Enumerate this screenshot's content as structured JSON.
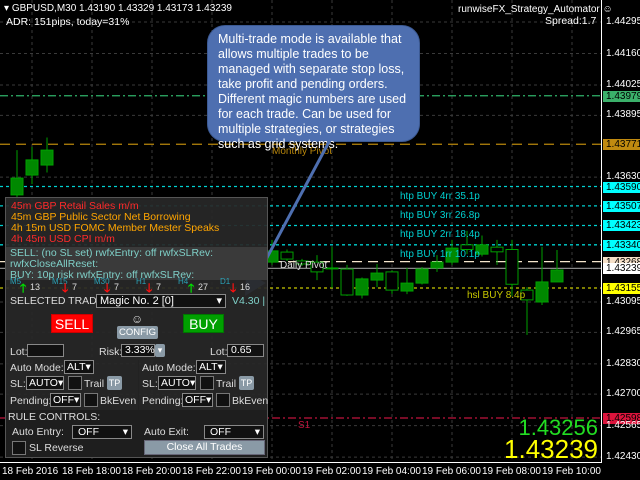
{
  "header": {
    "symbol_line": "GBPUSD,M30  1.43190 1.43329 1.43173 1.43239",
    "adr": "ADR: 151pips, today=31%",
    "ea_name": "runwiseFX_Strategy_Automator",
    "spread": "Spread:1.7"
  },
  "price_axis": [
    "1.44295",
    "1.44160",
    "1.44025",
    "1.43895",
    "1.43630",
    "1.43095",
    "1.42965",
    "1.42830",
    "1.42700",
    "1.42565",
    "1.42430"
  ],
  "levels": [
    {
      "price": 1.43979,
      "text": "1.43979",
      "color": "#2fb36a",
      "style": "dashdot",
      "badge_bg": "#3bb06a",
      "label": ""
    },
    {
      "price": 1.43771,
      "text": "1.43771",
      "color": "#b8860b",
      "style": "dashed",
      "badge_bg": "#c08a10",
      "label": "Monthly Pivot"
    },
    {
      "price": 1.4359,
      "text": "1.43590",
      "color": "#00d0d0",
      "style": "dotted",
      "badge_bg": "#00ffff",
      "label": "htp BUY 4rr 35.1p"
    },
    {
      "price": 1.43507,
      "text": "1.43507",
      "color": "#00d0d0",
      "style": "dotted",
      "badge_bg": "#00ffff",
      "label": "htp BUY 3rr 26.8p"
    },
    {
      "price": 1.43423,
      "text": "1.43423",
      "color": "#00d0d0",
      "style": "dotted",
      "badge_bg": "#00ffff",
      "label": "htp BUY 2rr 18.4p"
    },
    {
      "price": 1.4334,
      "text": "1.43340",
      "color": "#00d0d0",
      "style": "dotted",
      "badge_bg": "#00ffff",
      "label": "htp BUY 1rr 10.1p"
    },
    {
      "price": 1.43268,
      "text": "1.43268",
      "color": "#f5e6cc",
      "style": "dashed",
      "badge_bg": "#f5e0c8",
      "label": "Daily Pivot"
    },
    {
      "price": 1.43239,
      "text": "1.43239",
      "color": "#888888",
      "style": "solid",
      "badge_bg": "#ffffff",
      "label": ""
    },
    {
      "price": 1.43155,
      "text": "1.43155",
      "color": "#c8c800",
      "style": "dotted",
      "badge_bg": "#ffff00",
      "label": "hsl BUY 8.4p"
    },
    {
      "price": 1.42598,
      "text": "1.42598",
      "color": "#c0143c",
      "style": "dashdot",
      "badge_bg": "#dc143c",
      "label": "S1"
    }
  ],
  "time_axis": [
    "18 Feb 2016",
    "18 Feb 18:00",
    "18 Feb 20:00",
    "18 Feb 22:00",
    "19 Feb 00:00",
    "19 Feb 02:00",
    "19 Feb 04:00",
    "19 Feb 06:00",
    "19 Feb 08:00",
    "19 Feb 10:00"
  ],
  "candles": [
    [
      0,
      1.43554,
      1.43746,
      1.43532,
      1.43626
    ],
    [
      1,
      1.43639,
      1.4376,
      1.436,
      1.43704
    ],
    [
      2,
      1.43682,
      1.438,
      1.4365,
      1.43746
    ],
    [
      17,
      1.43266,
      1.43361,
      1.43254,
      1.43314
    ],
    [
      18,
      1.43309,
      1.4332,
      1.4327,
      1.43279
    ],
    [
      19,
      1.43271,
      1.4328,
      1.4325,
      1.43258
    ],
    [
      20,
      1.43266,
      1.43296,
      1.43189,
      1.43224
    ],
    [
      21,
      1.43241,
      1.43331,
      1.43155,
      1.43238
    ],
    [
      22,
      1.43236,
      1.43254,
      1.43121,
      1.43125
    ],
    [
      23,
      1.43125,
      1.432,
      1.4311,
      1.43194
    ],
    [
      24,
      1.43189,
      1.43258,
      1.43159,
      1.43219
    ],
    [
      25,
      1.43224,
      1.4323,
      1.4313,
      1.43146
    ],
    [
      26,
      1.43142,
      1.43241,
      1.43129,
      1.43176
    ],
    [
      27,
      1.43176,
      1.43245,
      1.4317,
      1.43236
    ],
    [
      28,
      1.43241,
      1.43296,
      1.43224,
      1.43266
    ],
    [
      29,
      1.43266,
      1.43361,
      1.43254,
      1.43326
    ],
    [
      30,
      1.4334,
      1.434,
      1.433,
      1.4332
    ],
    [
      31,
      1.433,
      1.4338,
      1.4329,
      1.4334
    ],
    [
      32,
      1.4333,
      1.43361,
      1.43254,
      1.4331
    ],
    [
      33,
      1.4332,
      1.43361,
      1.43121,
      1.43171
    ],
    [
      34,
      1.43146,
      1.43159,
      1.42954,
      1.43104
    ],
    [
      35,
      1.43095,
      1.43331,
      1.43082,
      1.43181
    ],
    [
      36,
      1.43181,
      1.43318,
      1.43181,
      1.43232
    ]
  ],
  "big_prices": {
    "ask": "1.43256",
    "bid": "1.43239"
  },
  "callout": "Multi-trade mode is available that allows multiple trades to be managed with separate stop loss, take profit and pending orders. Different magic numbers are used for each trade. Can be used for multiple strategies, or strategies such as grid systems.",
  "panel": {
    "news": [
      {
        "text": "45m GBP Retail Sales m/m",
        "color": "#ff2a2a"
      },
      {
        "text": "45m GBP Public Sector Net Borrowing",
        "color": "#ffa500"
      },
      {
        "text": "4h 15m USD FOMC Member Mester Speaks",
        "color": "#ffa500"
      },
      {
        "text": "4h 45m USD CPI m/m",
        "color": "#ff2a2a"
      }
    ],
    "status": [
      "SELL: (no SL set)  rwfxEntry: off rwfxSLRev:",
      "rwfxCloseAllReset:",
      "BUY: 10p risk  rwfxEntry: off rwfxSLRev:"
    ],
    "timeframes": [
      {
        "tf": "M5",
        "dir": "up",
        "count": "13"
      },
      {
        "tf": "M15",
        "dir": "down",
        "count": "7"
      },
      {
        "tf": "M30",
        "dir": "down",
        "count": "7"
      },
      {
        "tf": "H1",
        "dir": "down",
        "count": "7"
      },
      {
        "tf": "H4",
        "dir": "up",
        "count": "27"
      },
      {
        "tf": "D1",
        "dir": "down",
        "count": "16"
      }
    ],
    "selected_trade_label": "SELECTED TRADE:",
    "selected_trade": "Magic No. 2 [0]",
    "version": "V4.30 |",
    "sell": "SELL",
    "buy": "BUY",
    "config": "CONFIG",
    "lot_label": "Lot:",
    "sell_lot": "",
    "buy_lot": "0.65",
    "risk_label": "Risk:",
    "risk": "3.33%",
    "auto_mode_label": "Auto Mode:",
    "auto_mode_sell": "ALT",
    "auto_mode_buy": "ALT",
    "sl_label": "SL:",
    "sl_sell": "AUTO",
    "sl_buy": "AUTO",
    "trail": "Trail",
    "tp": "TP",
    "pending_label": "Pending:",
    "pending_sell": "OFF",
    "pending_buy": "OFF",
    "bkeven": "BkEven",
    "rule_controls": "RULE CONTROLS:",
    "auto_entry_label": "Auto Entry:",
    "auto_entry": "OFF",
    "auto_exit_label": "Auto Exit:",
    "auto_exit": "OFF",
    "sl_reverse": "SL Reverse",
    "close_all": "Close All Trades"
  }
}
